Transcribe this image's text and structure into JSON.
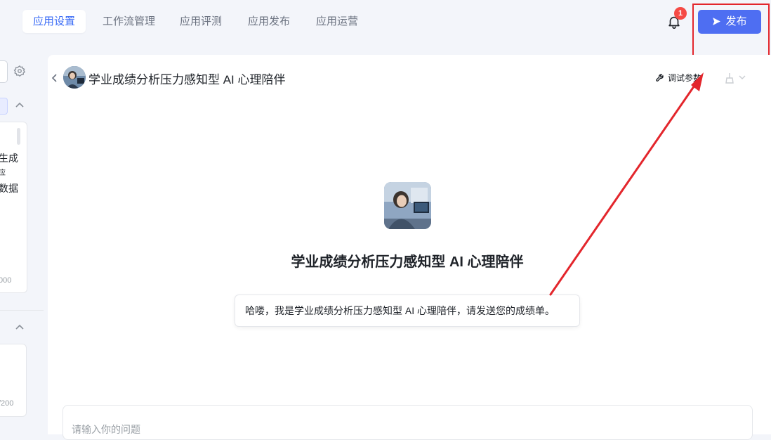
{
  "nav": {
    "tabs": [
      {
        "label": "应用设置",
        "active": true
      },
      {
        "label": "工作流管理",
        "active": false
      },
      {
        "label": "应用评测",
        "active": false
      },
      {
        "label": "应用发布",
        "active": false
      },
      {
        "label": "应用运营",
        "active": false
      }
    ],
    "notification_count": "1",
    "publish_label": "发布"
  },
  "left": {
    "text_line1": "生成",
    "text_line2": "应",
    "text_line3": "数据",
    "count1": "000",
    "count2": "/200"
  },
  "app": {
    "title": "学业成绩分析压力感知型 AI 心理陪伴",
    "debug_label": "调试参数",
    "greeting": "哈喽，我是学业成绩分析压力感知型 AI 心理陪伴，请发送您的成绩单。",
    "input_placeholder": "请输入你的问题"
  },
  "colors": {
    "accent": "#4e6ef2",
    "annotation": "#e3262c",
    "badge": "#f54a45"
  }
}
